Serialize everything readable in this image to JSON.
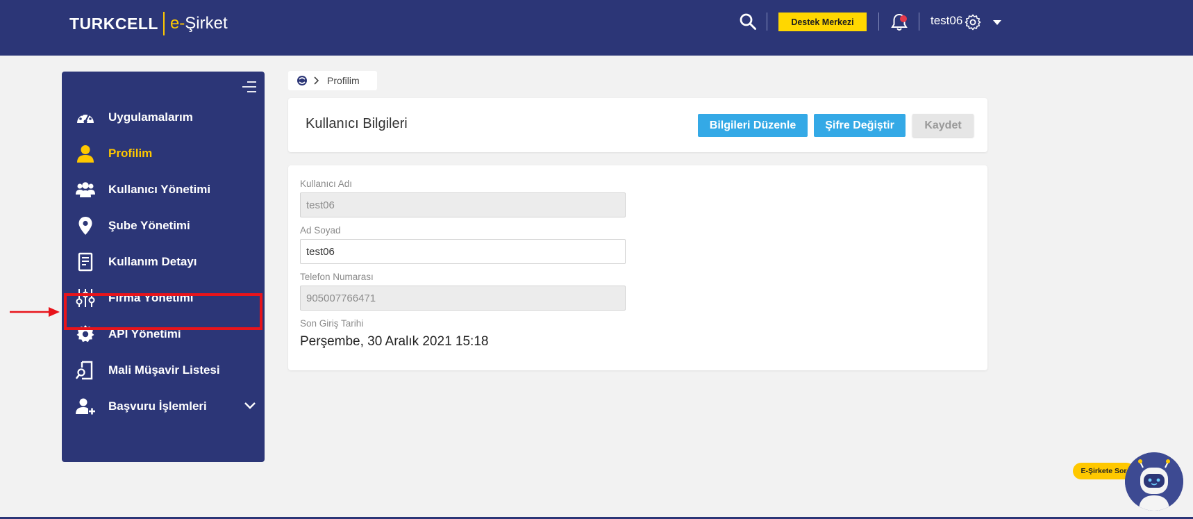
{
  "header": {
    "brand": "TURKCELL",
    "product_prefix": "e-",
    "product_name": "Şirket",
    "support_label": "Destek Merkezi",
    "username": "test06",
    "icons": [
      "search-icon",
      "bell-icon",
      "gear-icon",
      "caret-down-icon"
    ],
    "notification_color": "#e6394b"
  },
  "sidebar": {
    "items": [
      {
        "label": "Uygulamalarım",
        "icon": "dashboard-icon"
      },
      {
        "label": "Profilim",
        "icon": "user-icon",
        "active": true
      },
      {
        "label": "Kullanıcı Yönetimi",
        "icon": "users-icon"
      },
      {
        "label": "Şube Yönetimi",
        "icon": "map-pin-icon"
      },
      {
        "label": "Kullanım Detayı",
        "icon": "document-icon"
      },
      {
        "label": "Firma Yönetimi",
        "icon": "sliders-icon",
        "highlighted": true
      },
      {
        "label": "API Yönetimi",
        "icon": "gear-icon"
      },
      {
        "label": "Mali Müşavir Listesi",
        "icon": "doc-search-icon"
      },
      {
        "label": "Başvuru İşlemleri",
        "icon": "user-plus-icon",
        "expandable": true
      }
    ]
  },
  "breadcrumb": {
    "current": "Profilim"
  },
  "user_info": {
    "title": "Kullanıcı Bilgileri",
    "buttons": {
      "edit": "Bilgileri Düzenle",
      "change_password": "Şifre Değiştir",
      "save": "Kaydet"
    },
    "fields": {
      "username_label": "Kullanıcı Adı",
      "username_value": "test06",
      "fullname_label": "Ad Soyad",
      "fullname_value": "test06",
      "phone_label": "Telefon Numarası",
      "phone_value": "905007766471",
      "last_login_label": "Son Giriş Tarihi",
      "last_login_value": "Perşembe, 30 Aralık 2021 15:18"
    }
  },
  "chatbot": {
    "label": "E-Şirkete Sor"
  },
  "colors": {
    "primary": "#2c3677",
    "accent": "#ffc800",
    "button": "#34a9e6",
    "highlight": "#e8141b"
  }
}
